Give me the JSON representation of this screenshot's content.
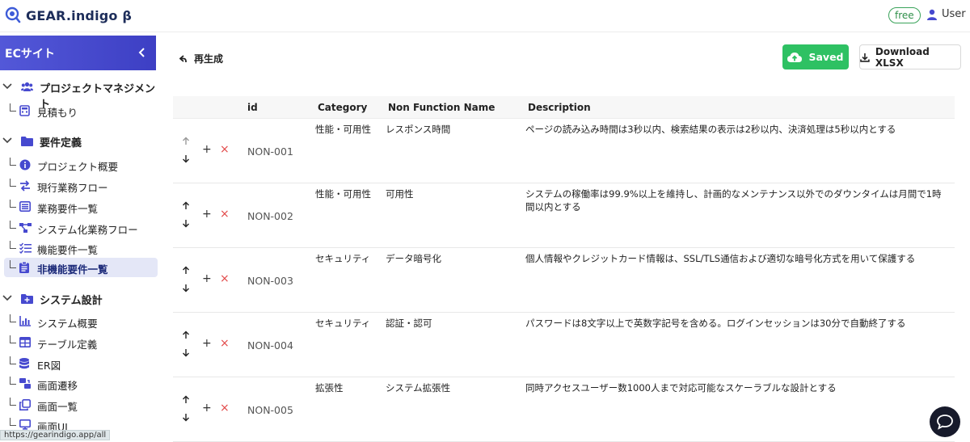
{
  "app": {
    "logo_text": "GEAR.indigo β",
    "plan_badge": "free",
    "user_label": "User"
  },
  "sidebar": {
    "project_title": "ECサイト",
    "sections": [
      {
        "label": "プロジェクトマネジメント",
        "icon": "users-icon",
        "items": [
          {
            "label": "見積もり",
            "icon": "calculator-icon"
          }
        ]
      },
      {
        "label": "要件定義",
        "icon": "folder-icon",
        "items": [
          {
            "label": "プロジェクト概要",
            "icon": "info-icon"
          },
          {
            "label": "現行業務フロー",
            "icon": "swap-icon"
          },
          {
            "label": "業務要件一覧",
            "icon": "list-icon"
          },
          {
            "label": "システム化業務フロー",
            "icon": "flow-icon"
          },
          {
            "label": "機能要件一覧",
            "icon": "checklist-icon"
          },
          {
            "label": "非機能要件一覧",
            "icon": "clipboard-icon",
            "active": true
          }
        ]
      },
      {
        "label": "システム設計",
        "icon": "folder-plus-icon",
        "items": [
          {
            "label": "システム概要",
            "icon": "chart-icon"
          },
          {
            "label": "テーブル定義",
            "icon": "table-icon"
          },
          {
            "label": "ER図",
            "icon": "database-icon"
          },
          {
            "label": "画面遷移",
            "icon": "transition-icon"
          },
          {
            "label": "画面一覧",
            "icon": "copy-icon"
          },
          {
            "label": "画面UI",
            "icon": "monitor-icon"
          }
        ]
      }
    ]
  },
  "status_url": "https://gearindigo.app/all",
  "toolbar": {
    "regenerate_label": "再生成",
    "saved_label": "Saved",
    "download_label": "Download XLSX"
  },
  "table": {
    "headers": {
      "id": "id",
      "category": "Category",
      "name": "Non Function Name",
      "description": "Description"
    },
    "rows": [
      {
        "id": "NON-001",
        "category": "性能・可用性",
        "name": "レスポンス時間",
        "description": "ページの読み込み時間は3秒以内、検索結果の表示は2秒以内、決済処理は5秒以内とする"
      },
      {
        "id": "NON-002",
        "category": "性能・可用性",
        "name": "可用性",
        "description": "システムの稼働率は99.9%以上を維持し、計画的なメンテナンス以外でのダウンタイムは月間で1時間以内とする"
      },
      {
        "id": "NON-003",
        "category": "セキュリティ",
        "name": "データ暗号化",
        "description": "個人情報やクレジットカード情報は、SSL/TLS通信および適切な暗号化方式を用いて保護する"
      },
      {
        "id": "NON-004",
        "category": "セキュリティ",
        "name": "認証・認可",
        "description": "パスワードは8文字以上で英数字記号を含める。ログインセッションは30分で自動終了する"
      },
      {
        "id": "NON-005",
        "category": "拡張性",
        "name": "システム拡張性",
        "description": "同時アクセスユーザー数1000人まで対応可能なスケーラブルな設計とする"
      }
    ]
  },
  "colors": {
    "accent": "#4649cf",
    "saved_green": "#2ec163",
    "delete_red": "#e24a4a"
  }
}
